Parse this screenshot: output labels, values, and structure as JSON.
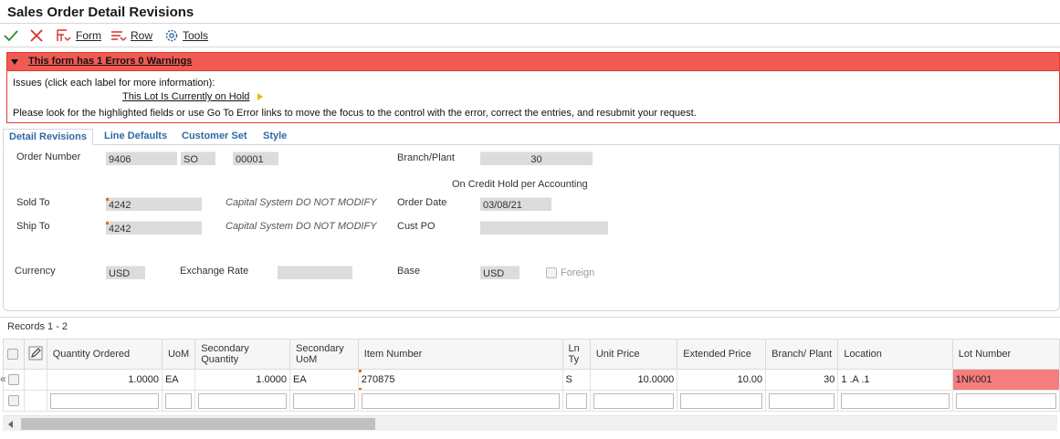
{
  "window": {
    "title": "Sales Order Detail Revisions"
  },
  "toolbar": {
    "form_label": "Form",
    "row_label": "Row",
    "tools_label": "Tools"
  },
  "error_panel": {
    "header": "This form has 1 Errors 0 Warnings",
    "issues_label": "Issues (click each label for more information):",
    "issue_link": "This Lot Is Currently on Hold",
    "instructions": "Please look for the highlighted fields or use Go To Error links to move the focus to the control with the error, correct the entries, and resubmit your request."
  },
  "tabs": [
    "Detail Revisions",
    "Line Defaults",
    "Customer Set",
    "Style"
  ],
  "form": {
    "order_number_label": "Order Number",
    "order_number": "9406",
    "order_type": "SO",
    "order_company": "00001",
    "branch_plant_label": "Branch/Plant",
    "branch_plant": "30",
    "credit_hold": "On Credit Hold per Accounting",
    "sold_to_label": "Sold To",
    "sold_to": "4242",
    "sold_to_name": "Capital System DO NOT MODIFY",
    "order_date_label": "Order Date",
    "order_date": "03/08/21",
    "ship_to_label": "Ship To",
    "ship_to": "4242",
    "ship_to_name": "Capital System DO NOT MODIFY",
    "cust_po_label": "Cust PO",
    "cust_po": "",
    "currency_label": "Currency",
    "currency": "USD",
    "exchange_rate_label": "Exchange Rate",
    "exchange_rate": "",
    "base_label": "Base",
    "base": "USD",
    "foreign_label": "Foreign"
  },
  "grid": {
    "records": "Records 1 - 2",
    "columns": [
      "Quantity Ordered",
      "UoM",
      "Secondary Quantity",
      "Secondary UoM",
      "Item Number",
      "Ln Ty",
      "Unit Price",
      "Extended Price",
      "Branch/ Plant",
      "Location",
      "Lot Number"
    ],
    "rows": [
      {
        "qty": "1.0000",
        "uom": "EA",
        "sec_qty": "1.0000",
        "sec_uom": "EA",
        "item": "270875",
        "ln_ty": "S",
        "unit_price": "10.0000",
        "ext_price": "10.00",
        "branch": "30",
        "location": "1 .A  .1",
        "lot": "1NK001"
      }
    ]
  },
  "colors": {
    "error_header": "#f05a52",
    "error_cell": "#f57d7d",
    "tab_text": "#2d6aa3",
    "accent_check": "#2e8b2e",
    "accent_x": "#d9302c"
  }
}
